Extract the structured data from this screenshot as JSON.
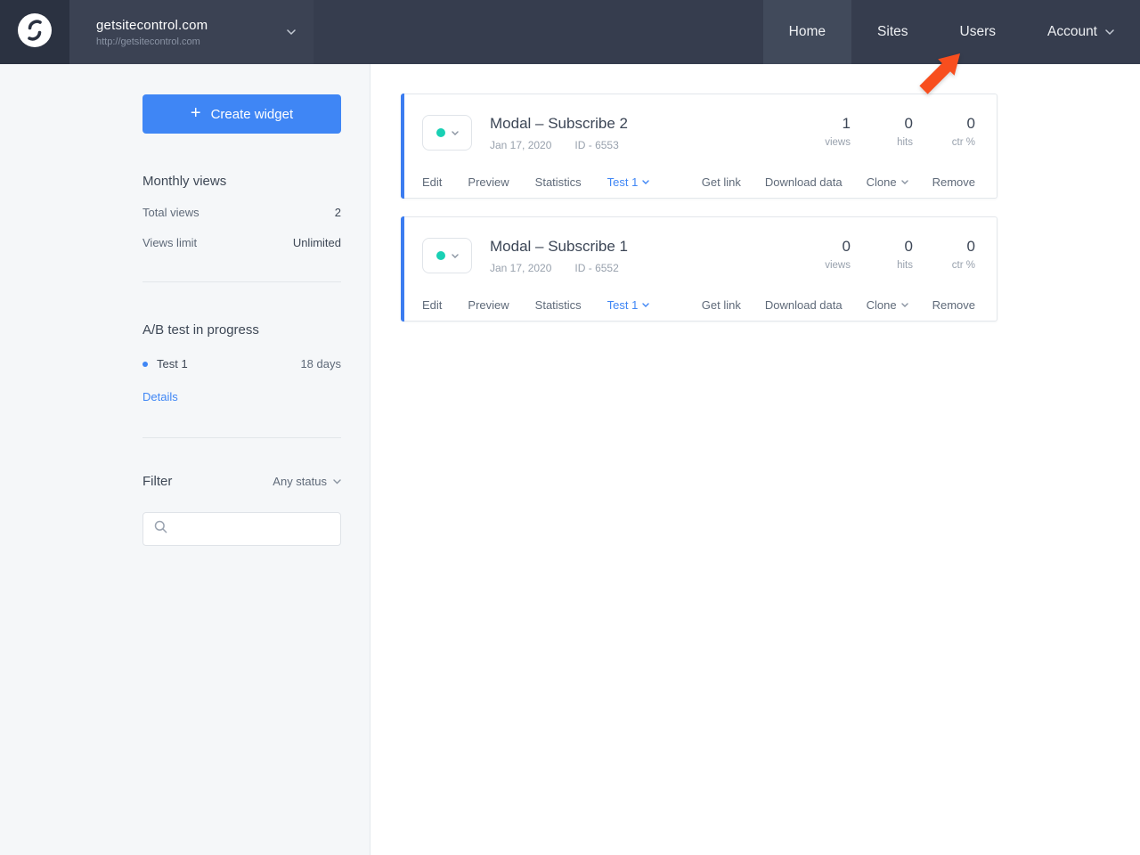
{
  "navbar": {
    "site": {
      "name": "getsitecontrol.com",
      "url": "http://getsitecontrol.com"
    },
    "items": [
      {
        "label": "Home",
        "active": true
      },
      {
        "label": "Sites",
        "active": false
      },
      {
        "label": "Users",
        "active": false
      },
      {
        "label": "Account",
        "active": false
      }
    ]
  },
  "sidebar": {
    "create_button_label": "Create widget",
    "monthly_views": {
      "title": "Monthly views",
      "rows": [
        {
          "label": "Total views",
          "value": "2"
        },
        {
          "label": "Views limit",
          "value": "Unlimited"
        }
      ]
    },
    "ab_test": {
      "title": "A/B test in progress",
      "test_name": "Test 1",
      "duration": "18 days",
      "details_link": "Details"
    },
    "filter": {
      "label": "Filter",
      "status_value": "Any status"
    }
  },
  "widgets": [
    {
      "title": "Modal – Subscribe 2",
      "date": "Jan 17, 2020",
      "widget_id": "ID - 6553",
      "stats": [
        {
          "value": "1",
          "label": "views"
        },
        {
          "value": "0",
          "label": "hits"
        },
        {
          "value": "0",
          "label": "ctr %"
        }
      ],
      "actions_left": [
        "Edit",
        "Preview",
        "Statistics"
      ],
      "test_label": "Test 1",
      "actions_right": [
        "Get link",
        "Download data",
        "Clone",
        "Remove"
      ]
    },
    {
      "title": "Modal – Subscribe 1",
      "date": "Jan 17, 2020",
      "widget_id": "ID - 6552",
      "stats": [
        {
          "value": "0",
          "label": "views"
        },
        {
          "value": "0",
          "label": "hits"
        },
        {
          "value": "0",
          "label": "ctr %"
        }
      ],
      "actions_left": [
        "Edit",
        "Preview",
        "Statistics"
      ],
      "test_label": "Test 1",
      "actions_right": [
        "Get link",
        "Download data",
        "Clone",
        "Remove"
      ]
    }
  ],
  "colors": {
    "accent_blue": "#3f86f5",
    "navbar_bg": "#363d4e",
    "teal_status": "#19d0b4",
    "arrow_orange": "#f84e1e"
  }
}
